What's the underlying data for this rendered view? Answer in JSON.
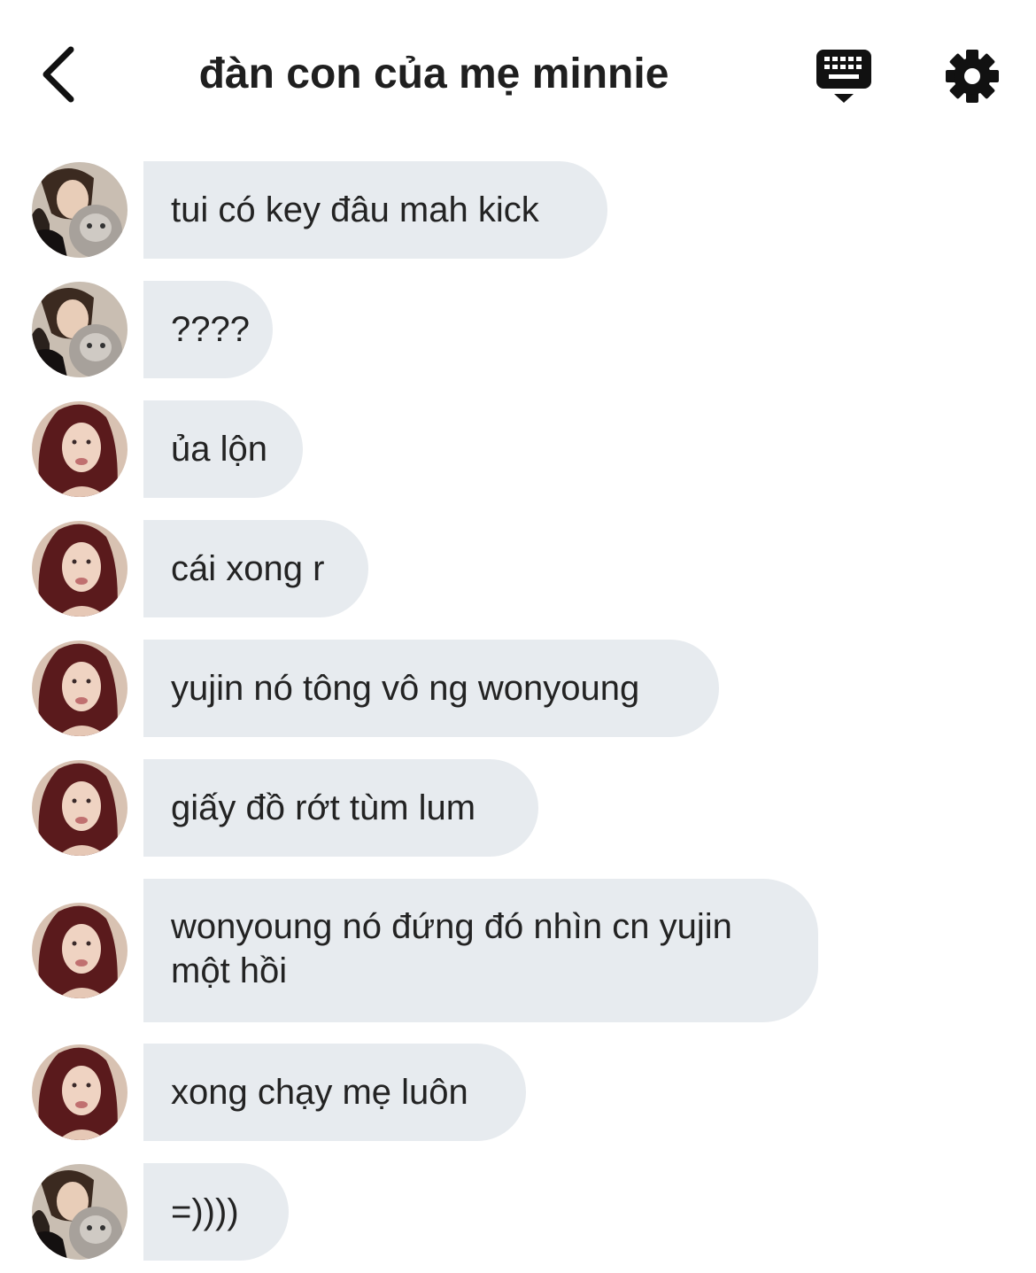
{
  "header": {
    "title": "đàn con của mẹ minnie",
    "back_icon": "chevron-left-icon",
    "keyboard_icon": "keyboard-icon",
    "settings_icon": "gear-icon"
  },
  "messages": [
    {
      "sender": "a",
      "text": "tui có key đâu mah kick"
    },
    {
      "sender": "a",
      "text": "????"
    },
    {
      "sender": "b",
      "text": "ủa lộn"
    },
    {
      "sender": "b",
      "text": "cái xong r"
    },
    {
      "sender": "b",
      "text": "yujin nó tông vô ng wonyoung"
    },
    {
      "sender": "b",
      "text": "giấy đồ rớt tùm lum"
    },
    {
      "sender": "b",
      "text": "wonyoung nó đứng đó nhìn cn yujin\nmột hồi"
    },
    {
      "sender": "b",
      "text": "xong chạy mẹ luôn"
    },
    {
      "sender": "a",
      "text": "=))))"
    }
  ],
  "colors": {
    "bubble": "#e7ebef",
    "text": "#232323",
    "background": "#ffffff"
  }
}
